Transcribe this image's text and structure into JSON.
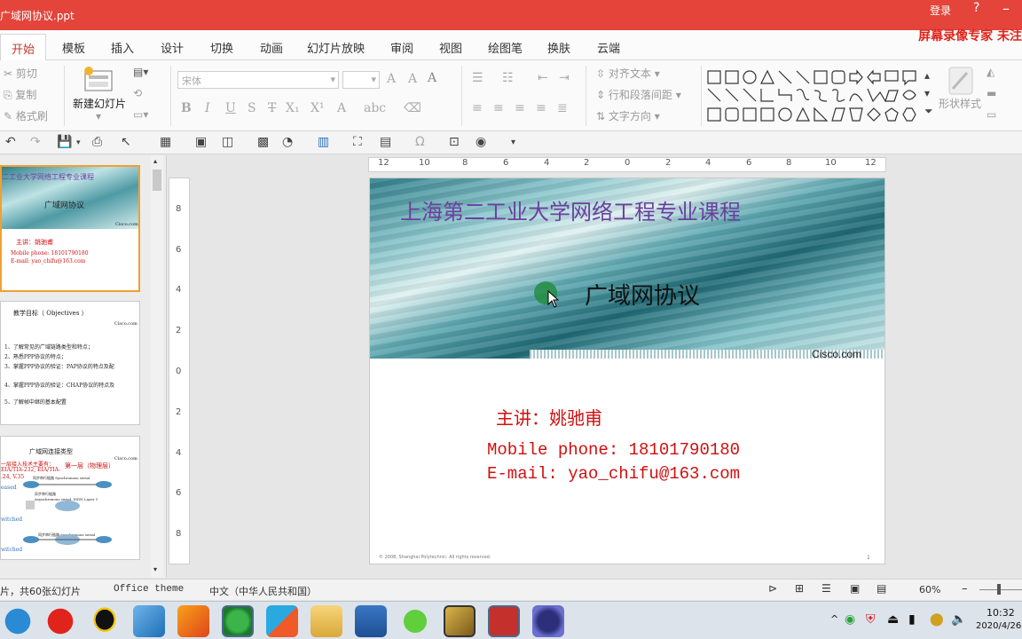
{
  "window": {
    "title": "广域网协议.ppt",
    "login": "登录",
    "help": "?",
    "minimize": "–"
  },
  "watermark": "屏幕录像专家 未注",
  "tabs": [
    "开始",
    "模板",
    "插入",
    "设计",
    "切换",
    "动画",
    "幻灯片放映",
    "审阅",
    "视图",
    "绘图笔",
    "换肤",
    "云端"
  ],
  "active_tab": "开始",
  "ribbon": {
    "cut": "剪切",
    "copy": "复制",
    "format_painter": "格式刷",
    "new_slide": "新建幻灯片",
    "font_name": "宋体",
    "align_text": "对齐文本",
    "line_spacing": "行和段落间距",
    "text_direction": "文字方向",
    "shape_style": "形状样式"
  },
  "hruler_ticks": [
    "12",
    "10",
    "8",
    "6",
    "4",
    "2",
    "0",
    "2",
    "4",
    "6",
    "8",
    "10",
    "12"
  ],
  "vruler_ticks": [
    "8",
    "6",
    "4",
    "2",
    "0",
    "2",
    "4",
    "6",
    "8"
  ],
  "thumbnails": {
    "t1": {
      "heading": "二工业大学网络工程专业课程",
      "title": "广域网协议",
      "brand": "Cisco.com",
      "presenter": "主讲：姚驰甫",
      "phone": "Mobile phone: 18101790180",
      "email": "E-mail: yao_chifu@163.com"
    },
    "t2": {
      "title": "教学目标（ Objectives ）",
      "brand": "Cisco.com",
      "items": [
        "1、了解常见的广域链路类型和特点；",
        "2、熟悉PPP协议的特点；",
        "3、掌握PPP协议的验证：PAP协议的特点及配",
        "4、掌握PPP协议的验证：CHAP协议的特点及",
        "5、了解帧中继的基本配置"
      ]
    },
    "t3": {
      "title": "广域网连接类型",
      "left1": "一层接入技术主要有：",
      "left2": "EIA/TIA-232, EIA/TIA-",
      "left3": ".24, V.35",
      "tag": "第一层（物理层）",
      "left4": "eased",
      "left5": "witched",
      "left6": "witched",
      "c1": "同步串行链路 Synchronous serial",
      "c2": "异步串行链路",
      "c3": "Asynchronous serial, ISDN Layer 1",
      "c4": "同步串行链路 Synchronous serial",
      "brand": "Cisco.com"
    }
  },
  "slide": {
    "heading": "上海第二工业大学网络工程专业课程",
    "title": "广域网协议",
    "brand": "Cisco.com",
    "presenter": "主讲：姚驰甫",
    "phone": "Mobile phone: 18101790180",
    "email": "E-mail: yao_chifu@163.com",
    "copyright": "© 2008, Shanghai Polytechnic. All rights reserved.",
    "page_number": "1"
  },
  "status": {
    "slide_count": "片，共60张幻灯片",
    "theme": "Office theme",
    "language": "中文（中华人民共和国）",
    "zoom": "60%",
    "zoom_out": "–"
  },
  "taskbar": {
    "time": "10:32",
    "date": "2020/4/26",
    "apps": [
      "sogou-icon",
      "netease-music-icon",
      "qq-icon",
      "transfer-icon",
      "qq-game-icon",
      "360-browser-icon",
      "video-player-icon",
      "file-explorer-icon",
      "word-icon",
      "wechat-icon",
      "tool-icon",
      "wps-presentation-icon",
      "app-icon"
    ]
  },
  "colors": {
    "titlebar": "#e4443a",
    "slide_heading": "#6b3fa0",
    "slide_red": "#d01010",
    "selected_thumb": "#f0a030"
  }
}
